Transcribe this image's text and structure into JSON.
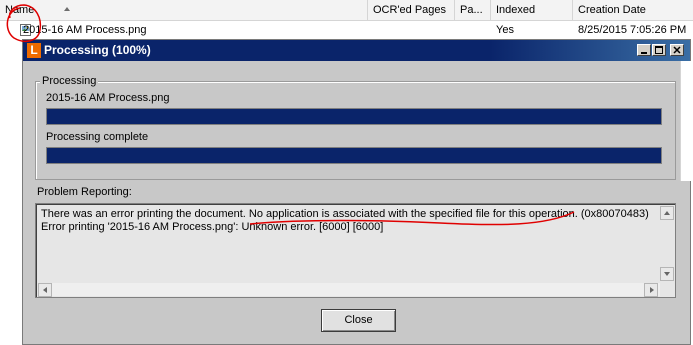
{
  "columns": {
    "name": "Name",
    "ocr_pages": "OCR'ed Pages",
    "pa": "Pa...",
    "indexed": "Indexed",
    "creation_date": "Creation Date"
  },
  "file": {
    "name": "2015-16 AM Process.png",
    "indexed": "Yes",
    "creation_date": "8/25/2015 7:05:26 PM"
  },
  "dialog": {
    "title": "Processing (100%)",
    "app_icon_letter": "L",
    "processing_group_label": "Processing",
    "current_file": "2015-16 AM Process.png",
    "file_progress": 1.0,
    "status": "Processing complete",
    "overall_progress": 1.0,
    "problem_label": "Problem Reporting:",
    "problem_lines": [
      "There was an error printing the document. No application is associated with the specified file for this operation. (0x80070483)",
      "Error printing '2015-16 AM Process.png': Unknown error. [6000] [6000]"
    ],
    "close_label": "Close"
  },
  "colors": {
    "titlebar": "#0a246a",
    "progress": "#0a246a",
    "annotation": "#e00000",
    "dialog_bg": "#c8c8c8"
  }
}
